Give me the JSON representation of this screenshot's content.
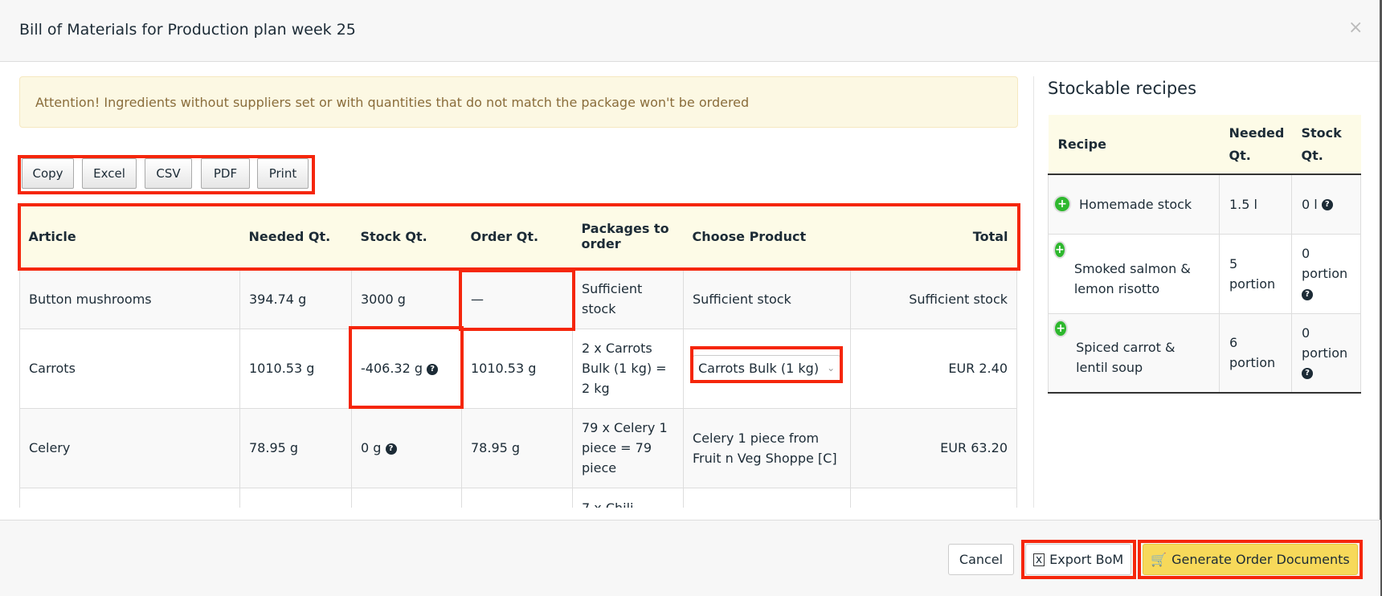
{
  "modal": {
    "title": "Bill of Materials for Production plan week 25",
    "close": "×"
  },
  "alert": "Attention! Ingredients without suppliers set or with quantities that do not match the package won't be ordered",
  "toolbar": {
    "copy": "Copy",
    "excel": "Excel",
    "csv": "CSV",
    "pdf": "PDF",
    "print": "Print"
  },
  "bom": {
    "headers": [
      "Article",
      "Needed Qt.",
      "Stock Qt.",
      "Order Qt.",
      "Packages to order",
      "Choose Product",
      "Total"
    ],
    "rows": [
      {
        "article": "Button mushrooms",
        "needed": "394.74 g",
        "stock": "3000 g",
        "order": "—",
        "packages": "Sufficient stock",
        "product": "Sufficient stock",
        "total": "Sufficient stock"
      },
      {
        "article": "Carrots",
        "needed": "1010.53 g",
        "stock": "-406.32 g",
        "order": "1010.53 g",
        "packages": "2 x Carrots Bulk (1 kg) = 2 kg",
        "product": "Carrots Bulk (1 kg)",
        "total": "EUR 2.40"
      },
      {
        "article": "Celery",
        "needed": "78.95 g",
        "stock": "0 g",
        "order": "78.95 g",
        "packages": "79 x Celery 1 piece = 79 piece",
        "product": "Celery 1 piece from Fruit n Veg Shoppe [C]",
        "total": "EUR 63.20"
      },
      {
        "article": "",
        "needed": "",
        "stock": "",
        "order": "",
        "packages": "7 x Chili",
        "product": "",
        "total": ""
      }
    ]
  },
  "stockable": {
    "title": "Stockable recipes",
    "headers": [
      "Recipe",
      "Needed Qt.",
      "Stock Qt."
    ],
    "rows": [
      {
        "recipe": "Homemade stock",
        "needed": "1.5 l",
        "stock": "0 l"
      },
      {
        "recipe": "Smoked salmon & lemon risotto",
        "needed": "5 portion",
        "stock": "0 portion"
      },
      {
        "recipe": "Spiced carrot & lentil soup",
        "needed": "6 portion",
        "stock": "0 portion"
      }
    ]
  },
  "footer": {
    "cancel": "Cancel",
    "export": "Export BoM",
    "generate": "Generate Order Documents"
  },
  "colors": {
    "accent": "#f7d95a",
    "highlight": "#f5260b",
    "alert_bg": "#fcf8e3",
    "header_bg": "#fdfbe7"
  }
}
